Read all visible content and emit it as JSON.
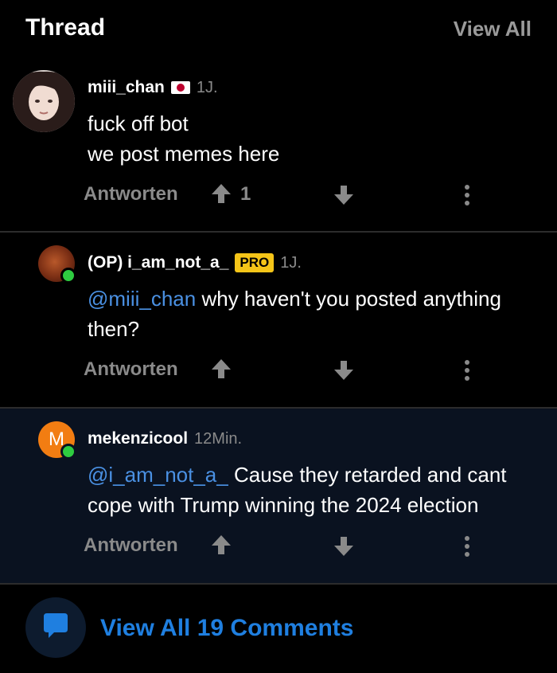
{
  "header": {
    "title": "Thread",
    "view_all": "View All"
  },
  "comments": [
    {
      "username": "miii_chan",
      "time": "1J.",
      "lines": [
        "fuck off  bot",
        "we post memes here"
      ],
      "reply": "Antworten",
      "upvotes": "1"
    },
    {
      "username": "(OP) i_am_not_a_",
      "badge": "PRO",
      "time": "1J.",
      "mention": "@miii_chan",
      "text": " why haven't you posted anything then?",
      "reply": "Antworten"
    },
    {
      "username": "mekenzicool",
      "avatar_letter": "M",
      "time": "12Min.",
      "mention": "@i_am_not_a_",
      "text": " Cause they retarded and cant cope with Trump winning the 2024 election",
      "reply": "Antworten"
    }
  ],
  "footer": {
    "link": "View All 19 Comments"
  },
  "colors": {
    "accent": "#1f7fe0",
    "mention": "#4a90e2",
    "pro_badge": "#f5c518",
    "online": "#2ecc40",
    "avatar_orange": "#f27d12"
  }
}
